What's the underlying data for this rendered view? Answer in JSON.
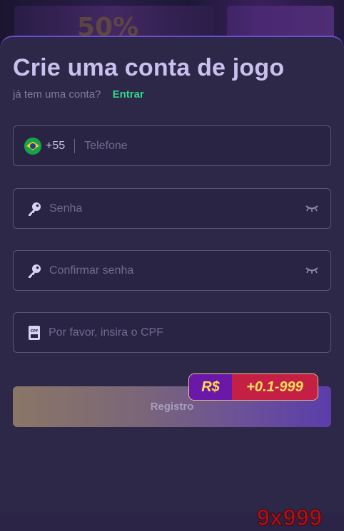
{
  "form": {
    "title": "Crie uma conta de jogo",
    "have_account": "já tem uma conta?",
    "login_link": "Entrar",
    "phone": {
      "country_code": "+55",
      "placeholder": "Telefone",
      "flag": "brazil-flag-icon"
    },
    "password": {
      "placeholder": "Senha",
      "icon": "key-icon",
      "toggle_icon": "eye-closed-icon"
    },
    "confirm_password": {
      "placeholder": "Confirmar senha",
      "icon": "key-icon",
      "toggle_icon": "eye-closed-icon"
    },
    "cpf": {
      "placeholder": "Por favor, insira o CPF",
      "icon": "cpf-card-icon"
    },
    "register_label": "Registro"
  },
  "bonus_badge": {
    "currency": "R$",
    "amount": "+0.1-999"
  },
  "watermark": "9x999",
  "colors": {
    "accent_green": "#2fd88a",
    "sheet_background": "#2e2848",
    "title_color": "#c9c0ee",
    "badge_purple": "#6a18a8",
    "badge_red": "#c42045"
  }
}
